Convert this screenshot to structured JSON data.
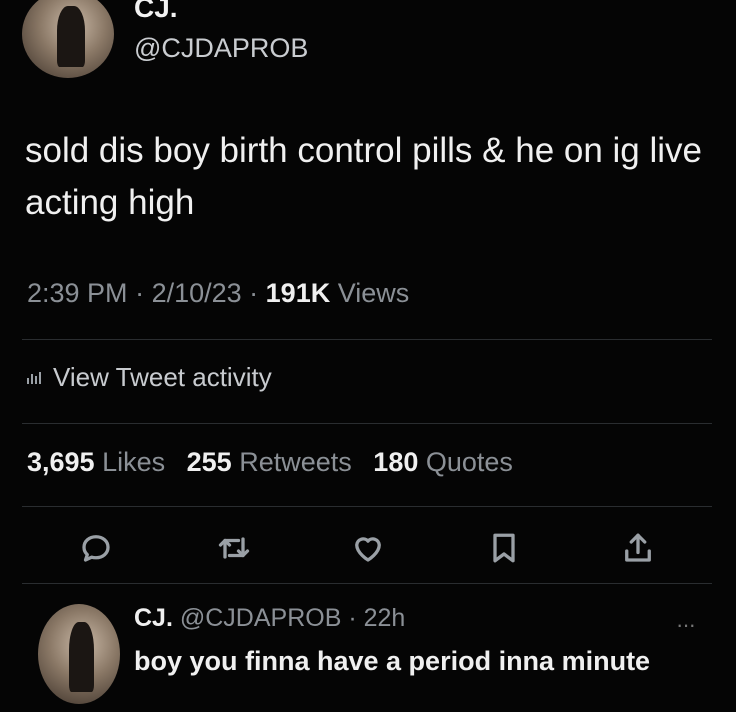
{
  "tweet": {
    "author_name": "CJ.",
    "author_handle": "@CJDAPROB",
    "text": "sold dis boy birth control pills & he on ig live acting high",
    "time": "2:39 PM",
    "date": "2/10/23",
    "views_count": "191K",
    "views_label": "Views",
    "activity_label": "View Tweet activity",
    "likes_count": "3,695",
    "likes_label": "Likes",
    "retweets_count": "255",
    "retweets_label": "Retweets",
    "quotes_count": "180",
    "quotes_label": "Quotes",
    "sep": " · "
  },
  "actions": {
    "icons": [
      "reply-icon",
      "retweet-icon",
      "like-icon",
      "bookmark-icon",
      "share-icon"
    ]
  },
  "reply": {
    "author_name": "CJ.",
    "author_handle": "@CJDAPROB",
    "age": "22h",
    "sep": " · ",
    "text": "boy you finna have a period inna minute"
  },
  "colors": {
    "background": "#050505",
    "text": "#f0f0f0",
    "muted": "#8b9096"
  }
}
